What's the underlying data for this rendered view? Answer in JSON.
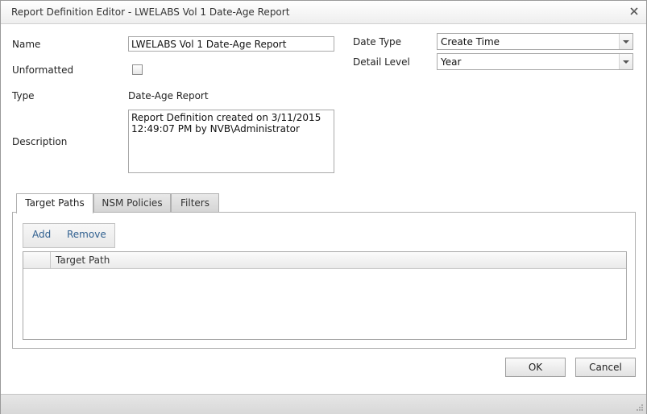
{
  "window": {
    "title": "Report Definition Editor - LWELABS Vol 1 Date-Age Report"
  },
  "form": {
    "name_label": "Name",
    "name_value": "LWELABS Vol 1 Date-Age Report",
    "unformatted_label": "Unformatted",
    "type_label": "Type",
    "type_value": "Date-Age Report",
    "description_label": "Description",
    "description_value": "Report Definition created on 3/11/2015 12:49:07 PM by NVB\\Administrator",
    "date_type_label": "Date Type",
    "date_type_value": "Create Time",
    "detail_level_label": "Detail Level",
    "detail_level_value": "Year"
  },
  "tabs": [
    {
      "label": "Target Paths",
      "active": true
    },
    {
      "label": "NSM Policies",
      "active": false
    },
    {
      "label": "Filters",
      "active": false
    }
  ],
  "toolbar": {
    "add_label": "Add",
    "remove_label": "Remove"
  },
  "grid": {
    "columns": [
      "Target Path"
    ],
    "rows": []
  },
  "buttons": {
    "ok_label": "OK",
    "cancel_label": "Cancel"
  },
  "colors": {
    "link_blue": "#2f5f8f",
    "border": "#a9a9a9"
  }
}
